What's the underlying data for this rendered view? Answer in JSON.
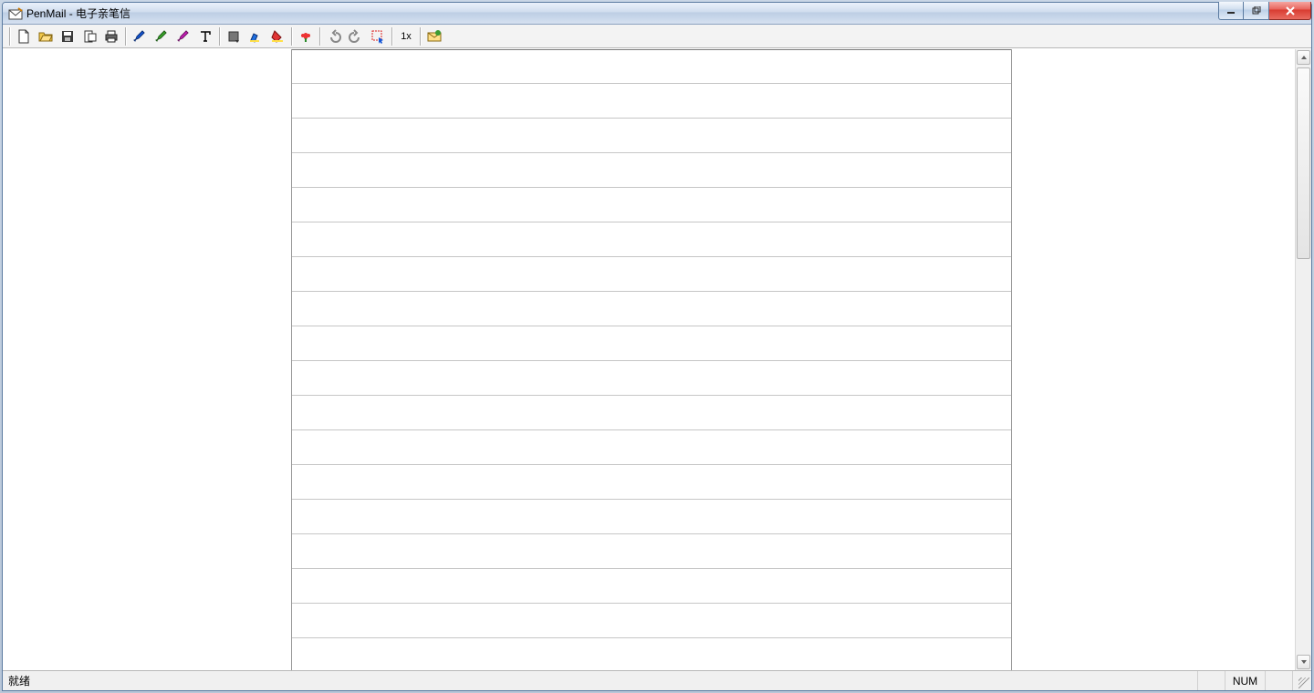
{
  "window": {
    "title": "PenMail - 电子亲笔信"
  },
  "toolbar": {
    "new": "new-file-icon",
    "open": "open-file-icon",
    "save": "save-icon",
    "page_setup": "page-setup-icon",
    "print": "print-icon",
    "pen": "pen-icon",
    "pencil": "pencil-icon",
    "eraser": "eraser-icon",
    "text": "text-icon",
    "color": "color-swatch-icon",
    "highlighter": "highlighter-icon",
    "fill": "fill-color-icon",
    "stamp": "stamp-flower-icon",
    "undo": "undo-icon",
    "redo": "redo-icon",
    "select": "select-tool-icon",
    "scale": "1x",
    "mail": "send-mail-icon"
  },
  "statusbar": {
    "ready": "就绪",
    "num": "NUM"
  }
}
